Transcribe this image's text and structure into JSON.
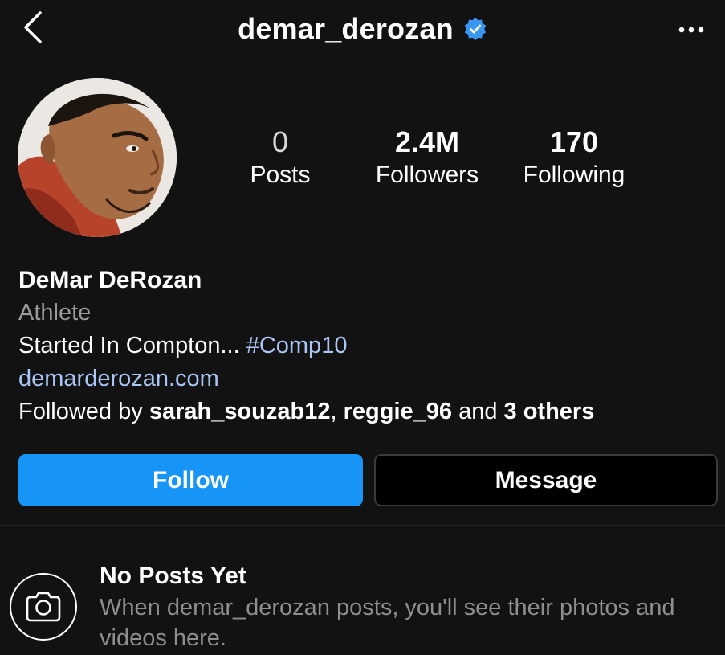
{
  "header": {
    "username": "demar_derozan",
    "verified_icon": "verified-badge-icon",
    "back_icon": "chevron-left-icon",
    "more_icon": "more-horizontal-icon"
  },
  "stats": {
    "posts": {
      "value": "0",
      "label": "Posts"
    },
    "followers": {
      "value": "2.4M",
      "label": "Followers"
    },
    "following": {
      "value": "170",
      "label": "Following"
    }
  },
  "bio": {
    "name": "DeMar DeRozan",
    "category": "Athlete",
    "text": "Started In Compton... ",
    "hashtag": "#Comp10",
    "link": "demarderozan.com",
    "followed_by_prefix": "Followed by ",
    "followed_user_1": "sarah_souzab12",
    "separator": ", ",
    "followed_user_2": "reggie_96",
    "and_text": " and ",
    "others": "3 others"
  },
  "actions": {
    "follow_label": "Follow",
    "message_label": "Message"
  },
  "empty_state": {
    "icon": "camera-icon",
    "title": "No Posts Yet",
    "description": "When demar_derozan posts, you'll see their photos and videos here."
  },
  "colors": {
    "background": "#121212",
    "accent_blue": "#1795f6",
    "link_blue": "#a9c6f6",
    "muted_text": "#8e8e8e",
    "verified_blue": "#3897f0"
  }
}
